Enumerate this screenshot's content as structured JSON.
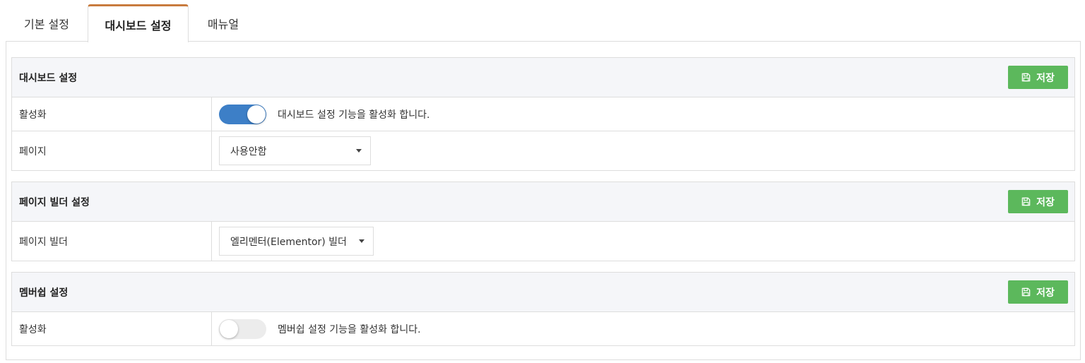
{
  "tabs": [
    {
      "label": "기본 설정",
      "active": false
    },
    {
      "label": "대시보드 설정",
      "active": true
    },
    {
      "label": "매뉴얼",
      "active": false
    }
  ],
  "colors": {
    "active_tab_accent": "#c87b3e",
    "save_button": "#5cb85c",
    "toggle_on": "#3d7fc7",
    "toggle_off": "#ececec"
  },
  "sections": {
    "dashboard": {
      "title": "대시보드 설정",
      "save_label": "저장",
      "save_icon": "floppy-disk-icon",
      "activate_label": "활성화",
      "activate_on": true,
      "activate_desc": "대시보드 설정 기능을 활성화 합니다.",
      "page_label": "페이지",
      "page_value": "사용안함"
    },
    "page_builder": {
      "title": "페이지 빌더 설정",
      "save_label": "저장",
      "save_icon": "floppy-disk-icon",
      "builder_label": "페이지 빌더",
      "builder_value": "엘리멘터(Elementor) 빌더"
    },
    "membership": {
      "title": "멤버쉽 설정",
      "save_label": "저장",
      "save_icon": "floppy-disk-icon",
      "activate_label": "활성화",
      "activate_on": false,
      "activate_desc": "멤버쉽 설정 기능을 활성화 합니다."
    }
  }
}
